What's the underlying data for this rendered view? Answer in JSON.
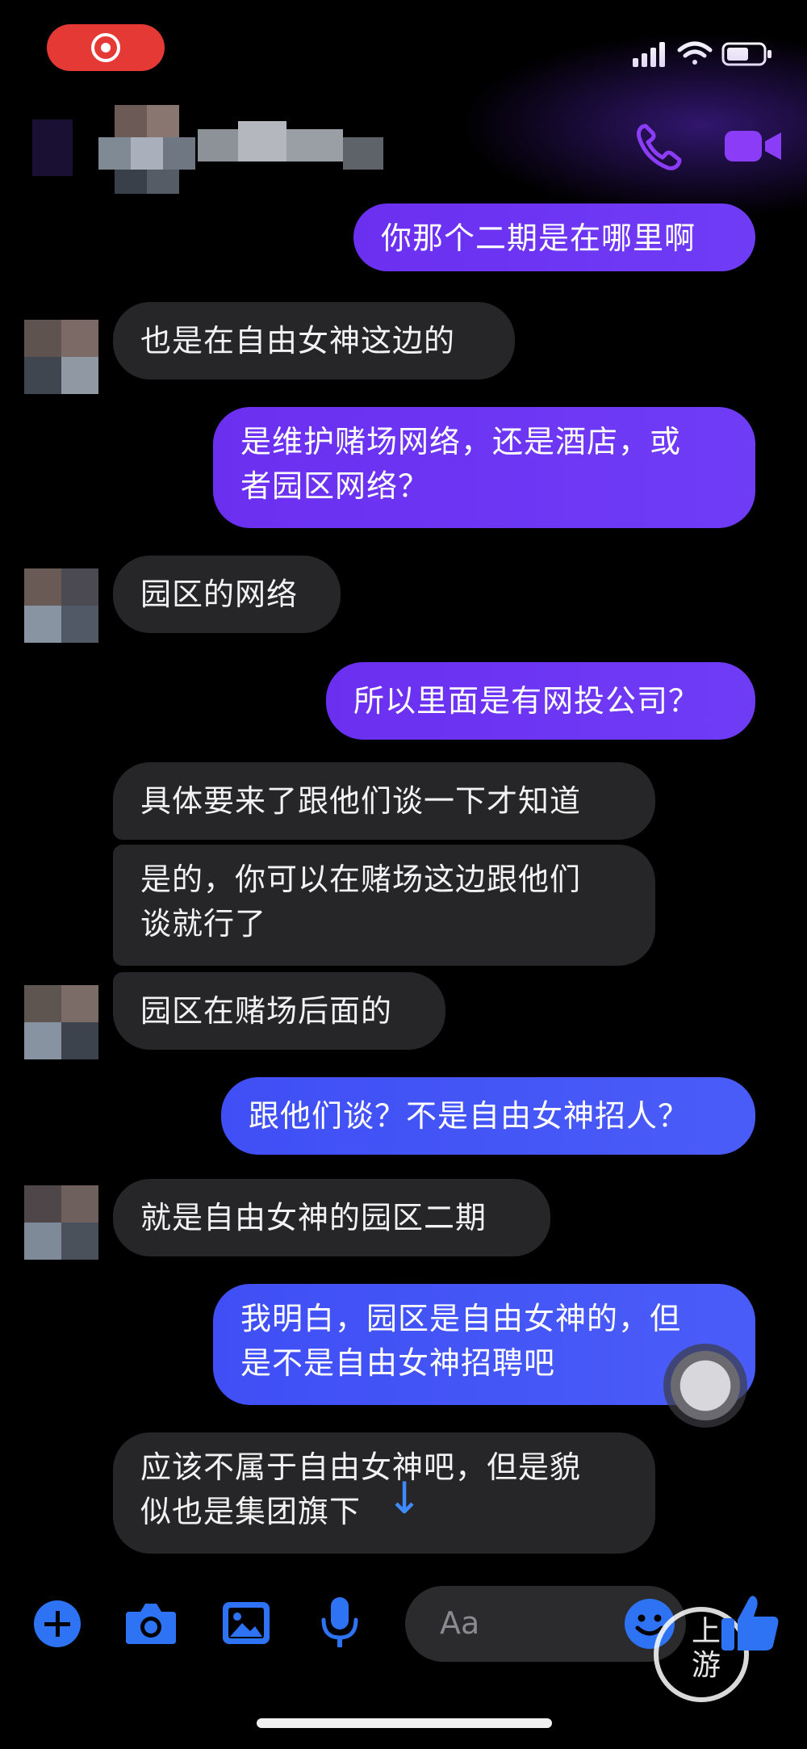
{
  "status_bar": {
    "recording_icon": "screen-record-icon",
    "signal_icon": "signal-bars-icon",
    "wifi_icon": "wifi-icon",
    "battery_icon": "battery-icon"
  },
  "header": {
    "call_icon": "phone-icon",
    "video_icon": "video-camera-icon",
    "accent_color": "#8b3cf7"
  },
  "messages": [
    {
      "sender": "me",
      "text": "你那个二期是在哪里啊"
    },
    {
      "sender": "them",
      "text": "也是在自由女神这边的"
    },
    {
      "sender": "me",
      "text": "是维护赌场网络，还是酒店，或\n者园区网络？"
    },
    {
      "sender": "them",
      "text": "园区的网络"
    },
    {
      "sender": "me",
      "text": "所以里面是有网投公司？"
    },
    {
      "sender": "them",
      "text": "具体要来了跟他们谈一下才知道"
    },
    {
      "sender": "them",
      "text": "是的，你可以在赌场这边跟他们\n谈就行了"
    },
    {
      "sender": "them",
      "text": "园区在赌场后面的"
    },
    {
      "sender": "me",
      "text": "跟他们谈？不是自由女神招人？"
    },
    {
      "sender": "them",
      "text": "就是自由女神的园区二期"
    },
    {
      "sender": "me",
      "text": "我明白，园区是自由女神的，但\n是不是自由女神招聘吧"
    },
    {
      "sender": "them",
      "text": "应该不属于自由女神吧，但是貌\n似也是集团旗下"
    }
  ],
  "composer": {
    "placeholder": "Aa",
    "add_icon": "plus-icon",
    "camera_icon": "camera-icon",
    "gallery_icon": "image-icon",
    "mic_icon": "microphone-icon",
    "emoji_icon": "emoji-icon",
    "like_icon": "thumbs-up-icon",
    "accent_color": "#2f73f5"
  },
  "overlay": {
    "scroll_down_icon": "arrow-down-icon",
    "assistive_touch_icon": "assistive-touch-icon"
  },
  "watermark": {
    "text": "上游"
  }
}
